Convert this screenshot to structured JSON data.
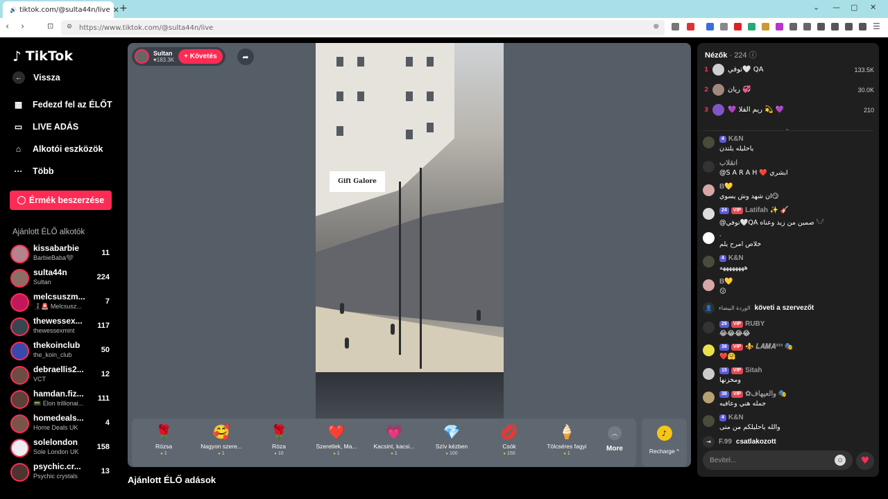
{
  "browser": {
    "tab_title": "tiktok.com/@sulta44n/live",
    "url": "https://www.tiktok.com/@sulta44n/live"
  },
  "sidebar": {
    "logo": "TikTok",
    "back": "Vissza",
    "nav": [
      {
        "label": "Fedezd fel az ÉLŐT",
        "icon": "calendar-icon"
      },
      {
        "label": "LIVE ADÁS",
        "icon": "video-camera-icon"
      },
      {
        "label": "Alkotói eszközök",
        "icon": "creator-tools-icon"
      },
      {
        "label": "Több",
        "icon": "more-dots-icon"
      }
    ],
    "coins_button": "Érmék beszerzése",
    "recommended_label": "Ajánlott ÉLŐ alkotók",
    "creators": [
      {
        "name": "kissabarbie",
        "sub": "BarbieBaba🖤",
        "count": "11"
      },
      {
        "name": "sulta44n",
        "sub": "Sultan",
        "count": "224"
      },
      {
        "name": "melcsuszm...",
        "sub": "👩‍🦯🚨 Melcsusz...",
        "count": "7"
      },
      {
        "name": "thewessex...",
        "sub": "thewessexmint",
        "count": "117"
      },
      {
        "name": "thekoinclub",
        "sub": "the_koin_club",
        "count": "50"
      },
      {
        "name": "debraellis2...",
        "sub": "VCT",
        "count": "12"
      },
      {
        "name": "hamdan.fiz...",
        "sub": "📟 Elon trillionai...",
        "count": "111"
      },
      {
        "name": "homedeals...",
        "sub": "Home Deals UK",
        "count": "4"
      },
      {
        "name": "solelondon",
        "sub": "Sole London UK",
        "count": "158"
      },
      {
        "name": "psychic.cr...",
        "sub": "Psychic crystals",
        "count": "13"
      }
    ]
  },
  "stream": {
    "host_name": "Sultan",
    "host_likes": "♥183.3K",
    "follow_label": "+ Követés",
    "video_sign": "Gift Galore",
    "gifts": [
      {
        "name": "Rózsa",
        "price": "1",
        "icon": "🌹"
      },
      {
        "name": "Nagyon szere...",
        "price": "1",
        "icon": "🥰"
      },
      {
        "name": "Róza",
        "price": "10",
        "icon": "🌹"
      },
      {
        "name": "Szeretlek, Ma...",
        "price": "1",
        "icon": "❤️"
      },
      {
        "name": "Kacsint, kacsi...",
        "price": "1",
        "icon": "💗"
      },
      {
        "name": "Szív kézben",
        "price": "100",
        "icon": "💎"
      },
      {
        "name": "Csók",
        "price": "150",
        "icon": "💋"
      },
      {
        "name": "Tölcséres fagyi",
        "price": "1",
        "icon": "🍦"
      }
    ],
    "more_label": "More",
    "recharge_label": "Recharge ^",
    "recommended_heading": "Ajánlott ÉLŐ adások"
  },
  "chat": {
    "viewers_label": "Nézők",
    "viewers_count": "· 224",
    "top_viewers": [
      {
        "rank": "1",
        "name": "توفي🤍 QA",
        "score": "133.5K"
      },
      {
        "rank": "2",
        "name": "ريان 💞",
        "score": "30.0K"
      },
      {
        "rank": "3",
        "name": "💜 ريم الفلا 💫 💜",
        "score": "210"
      }
    ],
    "messages": [
      {
        "level": "4",
        "vip": "",
        "name": "K&N",
        "text": "ياحليله يلتدن"
      },
      {
        "level": "",
        "vip": "",
        "name": "انقلاب",
        "text": "@S A R A H ❤️ ابشري"
      },
      {
        "level": "",
        "vip": "",
        "name": "B💛",
        "text": "ان شهد وش يسوي😏"
      },
      {
        "level": "24",
        "vip": "VIP",
        "name": "Latifah ✨ 🎸",
        "text": "@توفي🤍QA صمين من زيد وعناه 𓆩𓆪"
      },
      {
        "level": "",
        "vip": "",
        "name": ".",
        "text": "خلاص امرح يلم"
      },
      {
        "level": "4",
        "vip": "",
        "name": "K&N",
        "text": "ههههههههه"
      },
      {
        "level": "",
        "vip": "",
        "name": "B💛",
        "text": "😗"
      },
      {
        "level": "29",
        "vip": "VIP",
        "name": "RUBY",
        "text": "😂😂😂😂"
      },
      {
        "level": "38",
        "vip": "VIP",
        "name": "⚜️ 𝑳𝑨𝑴𝑨³³³ 🎭",
        "text": "❤️🤗"
      },
      {
        "level": "15",
        "vip": "VIP",
        "name": "Sitah",
        "text": "ومخزنها"
      },
      {
        "level": "38",
        "vip": "VIP",
        "name": "✿والعيهاف 🎭",
        "text": "جمله هني وعافيه"
      },
      {
        "level": "4",
        "vip": "",
        "name": "K&N",
        "text": "والله ياحليلكم من متى"
      }
    ],
    "system_follow": {
      "user": "الوردة البيضاء",
      "text": "követi a szervezőt"
    },
    "system_join": {
      "user": "F.99",
      "text": "csatlakozott"
    },
    "input_placeholder": "Bevitel..."
  }
}
